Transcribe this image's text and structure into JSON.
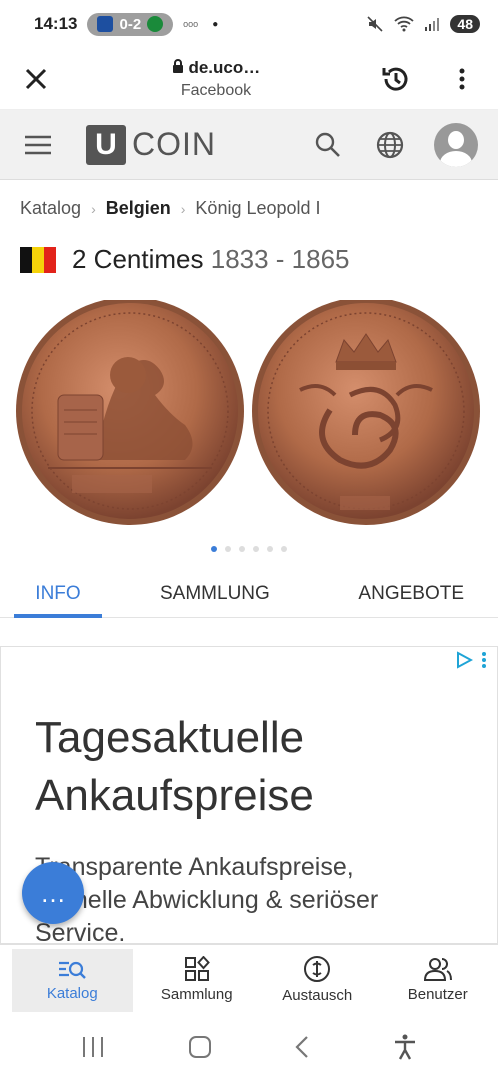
{
  "status": {
    "time": "14:13",
    "score": "0-2",
    "battery": "48"
  },
  "browser": {
    "url": "de.uco…",
    "site": "Facebook"
  },
  "ucoin": {
    "logo_letter": "U",
    "logo_text": "COIN"
  },
  "breadcrumb": {
    "items": [
      "Katalog",
      "Belgien",
      "König Leopold I"
    ]
  },
  "coin": {
    "name": "2 Centimes",
    "years": "1833 - 1865",
    "flag_colors": [
      "#111111",
      "#f5d20a",
      "#e2231a"
    ]
  },
  "carousel": {
    "count": 6,
    "active": 0
  },
  "tabs": [
    {
      "label": "INFO",
      "active": true
    },
    {
      "label": "SAMMLUNG",
      "active": false
    },
    {
      "label": "ANGEBOTE",
      "active": false
    }
  ],
  "ad": {
    "headline_1": "Tagesaktuelle",
    "headline_2": "Ankaufspreise",
    "sub_line_1": "Transparente Ankaufspreise,",
    "sub_line_2": "schnelle Abwicklung & seriöser",
    "sub_line_3": "Service."
  },
  "fab": {
    "label": "…"
  },
  "bottom_nav": [
    {
      "label": "Katalog",
      "icon": "catalog-search-icon",
      "active": true
    },
    {
      "label": "Sammlung",
      "icon": "collection-icon",
      "active": false
    },
    {
      "label": "Austausch",
      "icon": "exchange-icon",
      "active": false
    },
    {
      "label": "Benutzer",
      "icon": "users-icon",
      "active": false
    }
  ],
  "colors": {
    "accent": "#3b7dd8",
    "coin_copper": "#b06a48"
  }
}
